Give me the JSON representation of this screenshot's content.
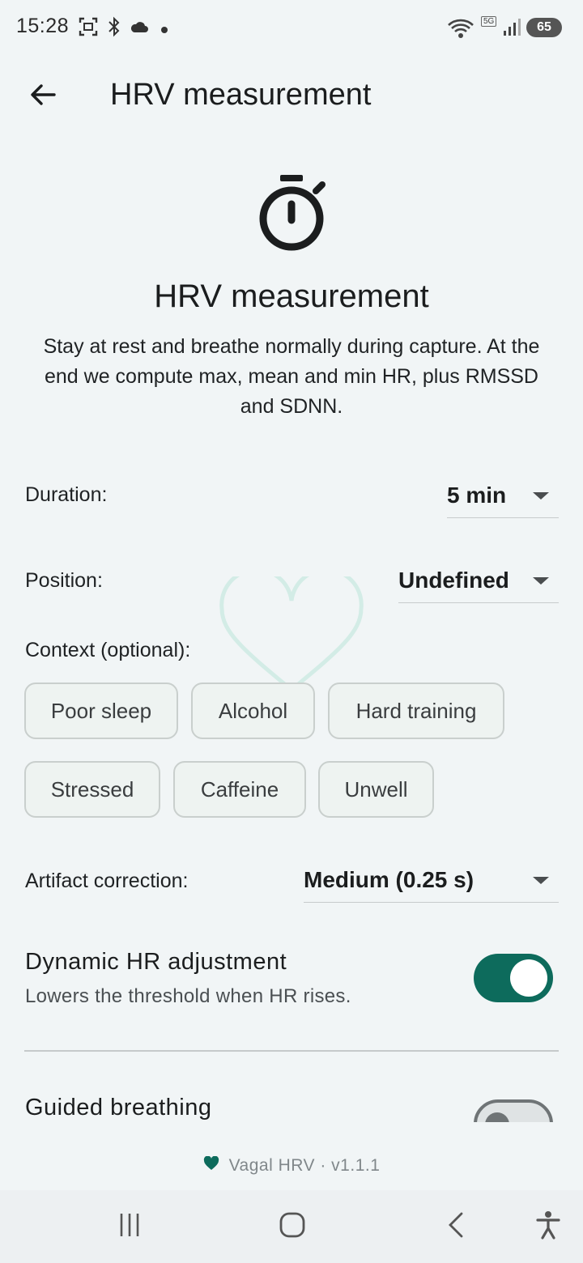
{
  "status_bar": {
    "time": "15:28",
    "battery": "65",
    "network": "5G"
  },
  "app_bar": {
    "title": "HRV measurement",
    "back_icon": "arrow-left-icon"
  },
  "hero": {
    "icon": "stopwatch-icon",
    "title": "HRV measurement",
    "description": "Stay at rest and breathe normally during capture. At the end we compute max, mean and min HR, plus RMSSD and SDNN."
  },
  "form": {
    "duration": {
      "label": "Duration:",
      "value": "5 min"
    },
    "position": {
      "label": "Position:",
      "value": "Undefined"
    },
    "context": {
      "label": "Context (optional):",
      "chips": [
        "Poor sleep",
        "Alcohol",
        "Hard training",
        "Stressed",
        "Caffeine",
        "Unwell"
      ]
    },
    "artifact": {
      "label": "Artifact correction:",
      "value": "Medium (0.25 s)"
    },
    "dynamic_hr": {
      "title": "Dynamic HR adjustment",
      "subtitle": "Lowers the threshold when HR rises.",
      "enabled": true
    },
    "guided_breathing": {
      "title": "Guided breathing",
      "enabled": false
    }
  },
  "footer": {
    "text": "Vagal HRV · v1.1.1",
    "icon": "heart-icon"
  },
  "colors": {
    "accent": "#0d6b5c",
    "background": "#f1f5f6"
  }
}
